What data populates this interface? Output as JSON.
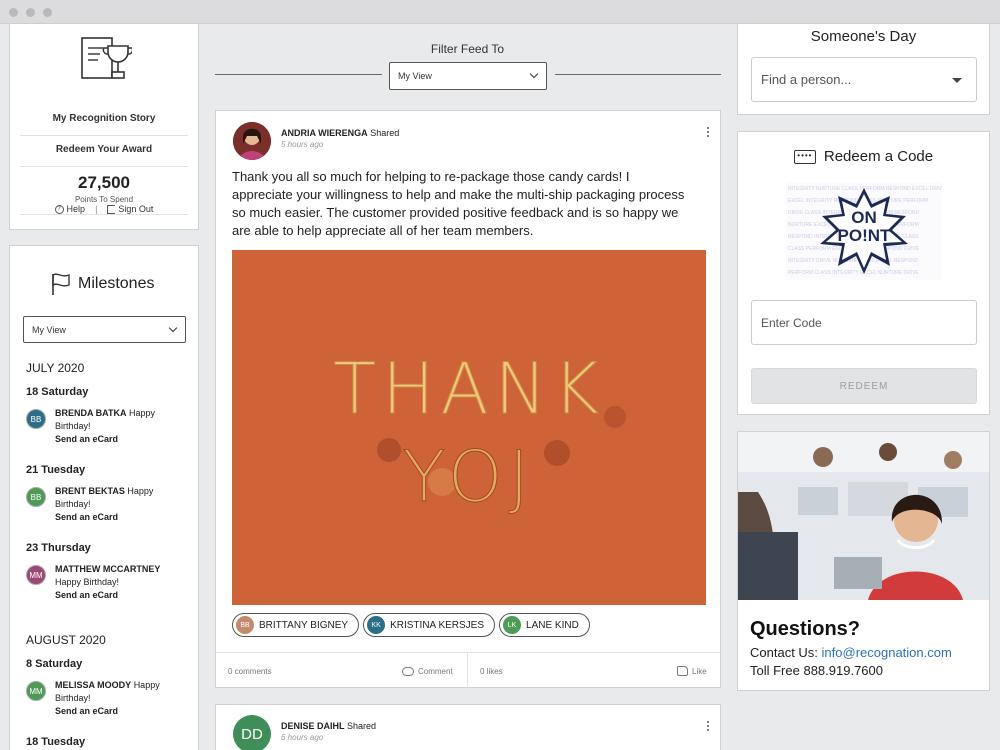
{
  "profile": {
    "story_label": "My Recognition Story",
    "redeem_label": "Redeem Your Award",
    "points_value": "27,500",
    "points_label": "Points To Spend",
    "help_label": "Help",
    "signout_label": "Sign Out"
  },
  "milestones": {
    "title": "Milestones",
    "view_select": "My View",
    "groups": [
      {
        "month": "JULY 2020"
      },
      {
        "month": "AUGUST 2020"
      }
    ],
    "entries": [
      {
        "day": "18 Saturday",
        "initials": "BB",
        "name": "BRENDA BATKA",
        "message": "Happy Birthday!",
        "action": "Send an eCard",
        "color": "#2c6e87"
      },
      {
        "day": "21 Tuesday",
        "initials": "BB",
        "name": "BRENT BEKTAS",
        "message": "Happy Birthday!",
        "action": "Send an eCard",
        "color": "#4e9a56"
      },
      {
        "day": "23 Thursday",
        "initials": "MM",
        "name": "MATTHEW MCCARTNEY",
        "message": "Happy Birthday!",
        "action": "Send an eCard",
        "color": "#9c4874"
      },
      {
        "day": "8 Saturday",
        "initials": "MM",
        "name": "MELISSA MOODY",
        "message": "Happy Birthday!",
        "action": "Send an eCard",
        "color": "#4e9a56"
      },
      {
        "day": "18 Tuesday"
      }
    ]
  },
  "feed": {
    "filter_label": "Filter Feed To",
    "filter_select": "My View",
    "post": {
      "author": "ANDRIA WIERENGA",
      "verb": "Shared",
      "time": "5 hours ago",
      "body": "Thank you all so much for helping to re-package those candy cards! I appreciate your willingness to help and make the multi-ship packaging process so much easier. The customer provided positive feedback and is so happy we are able to help appreciate all of her team members.",
      "gif_line1": "THANK",
      "gif_line2": "YOJ",
      "tags": [
        {
          "initials": "BB",
          "name": "BRITTANY BIGNEY",
          "color": "#c38a6e"
        },
        {
          "initials": "KK",
          "name": "KRISTINA KERSJES",
          "color": "#2c6e87"
        },
        {
          "initials": "LK",
          "name": "LANE KIND",
          "color": "#4e9a56"
        }
      ],
      "comments": "0 comments",
      "comment_action": "Comment",
      "likes": "0 likes",
      "like_action": "Like"
    },
    "post2": {
      "initials": "DD",
      "author": "DENISE DAIHL",
      "verb": "Shared",
      "time": "6 hours ago"
    }
  },
  "someones_day": {
    "title": "Someone's Day",
    "placeholder": "Find a person..."
  },
  "redeem": {
    "title": "Redeem a Code",
    "badge_line1": "ON",
    "badge_line2": "PO!NT",
    "input_placeholder": "Enter Code",
    "button": "REDEEM"
  },
  "contact": {
    "title": "Questions?",
    "contact_prefix": "Contact Us:",
    "email": "info@recognation.com",
    "tollfree": "Toll Free 888.919.7600"
  },
  "colors": {
    "accent_link": "#2a73b8",
    "gif_bg": "#cf6338"
  }
}
